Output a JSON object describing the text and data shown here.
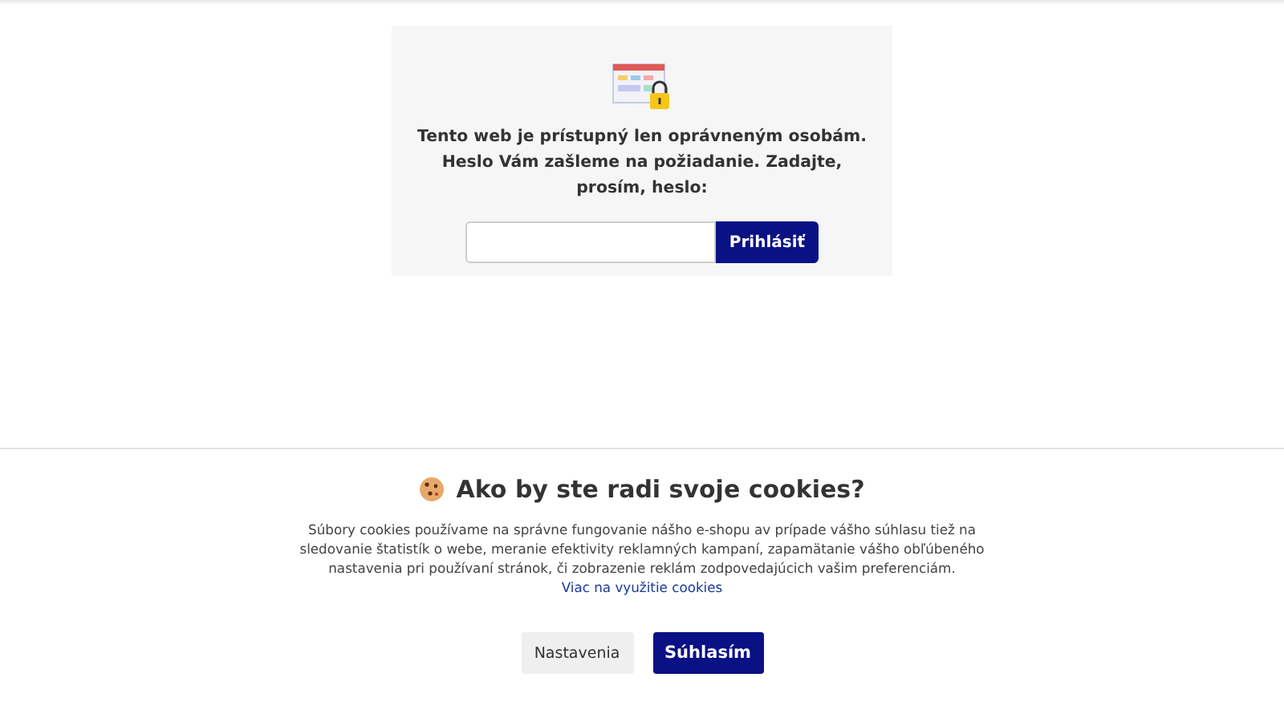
{
  "login": {
    "message": "Tento web je prístupný len oprávneným osobám. Heslo Vám zašleme na požiadanie. Zadajte, prosím, heslo:",
    "button": "Prihlásiť"
  },
  "cookies": {
    "title": "Ako by ste radi svoje cookies?",
    "text": "Súbory cookies používame na správne fungovanie nášho e-shopu av prípade vášho súhlasu tiež na sledovanie štatistík o webe, meranie efektivity reklamných kampaní, zapamätanie vášho obľúbeného nastavenia pri používaní stránok, či zobrazenie reklám zodpovedajúcich vašim preferenciám.",
    "link": "Viac na využitie cookies",
    "buttons": [
      {
        "label": "Nastavenia",
        "kind": "secondary"
      },
      {
        "label": "Súhlasím",
        "kind": "primary"
      }
    ]
  }
}
